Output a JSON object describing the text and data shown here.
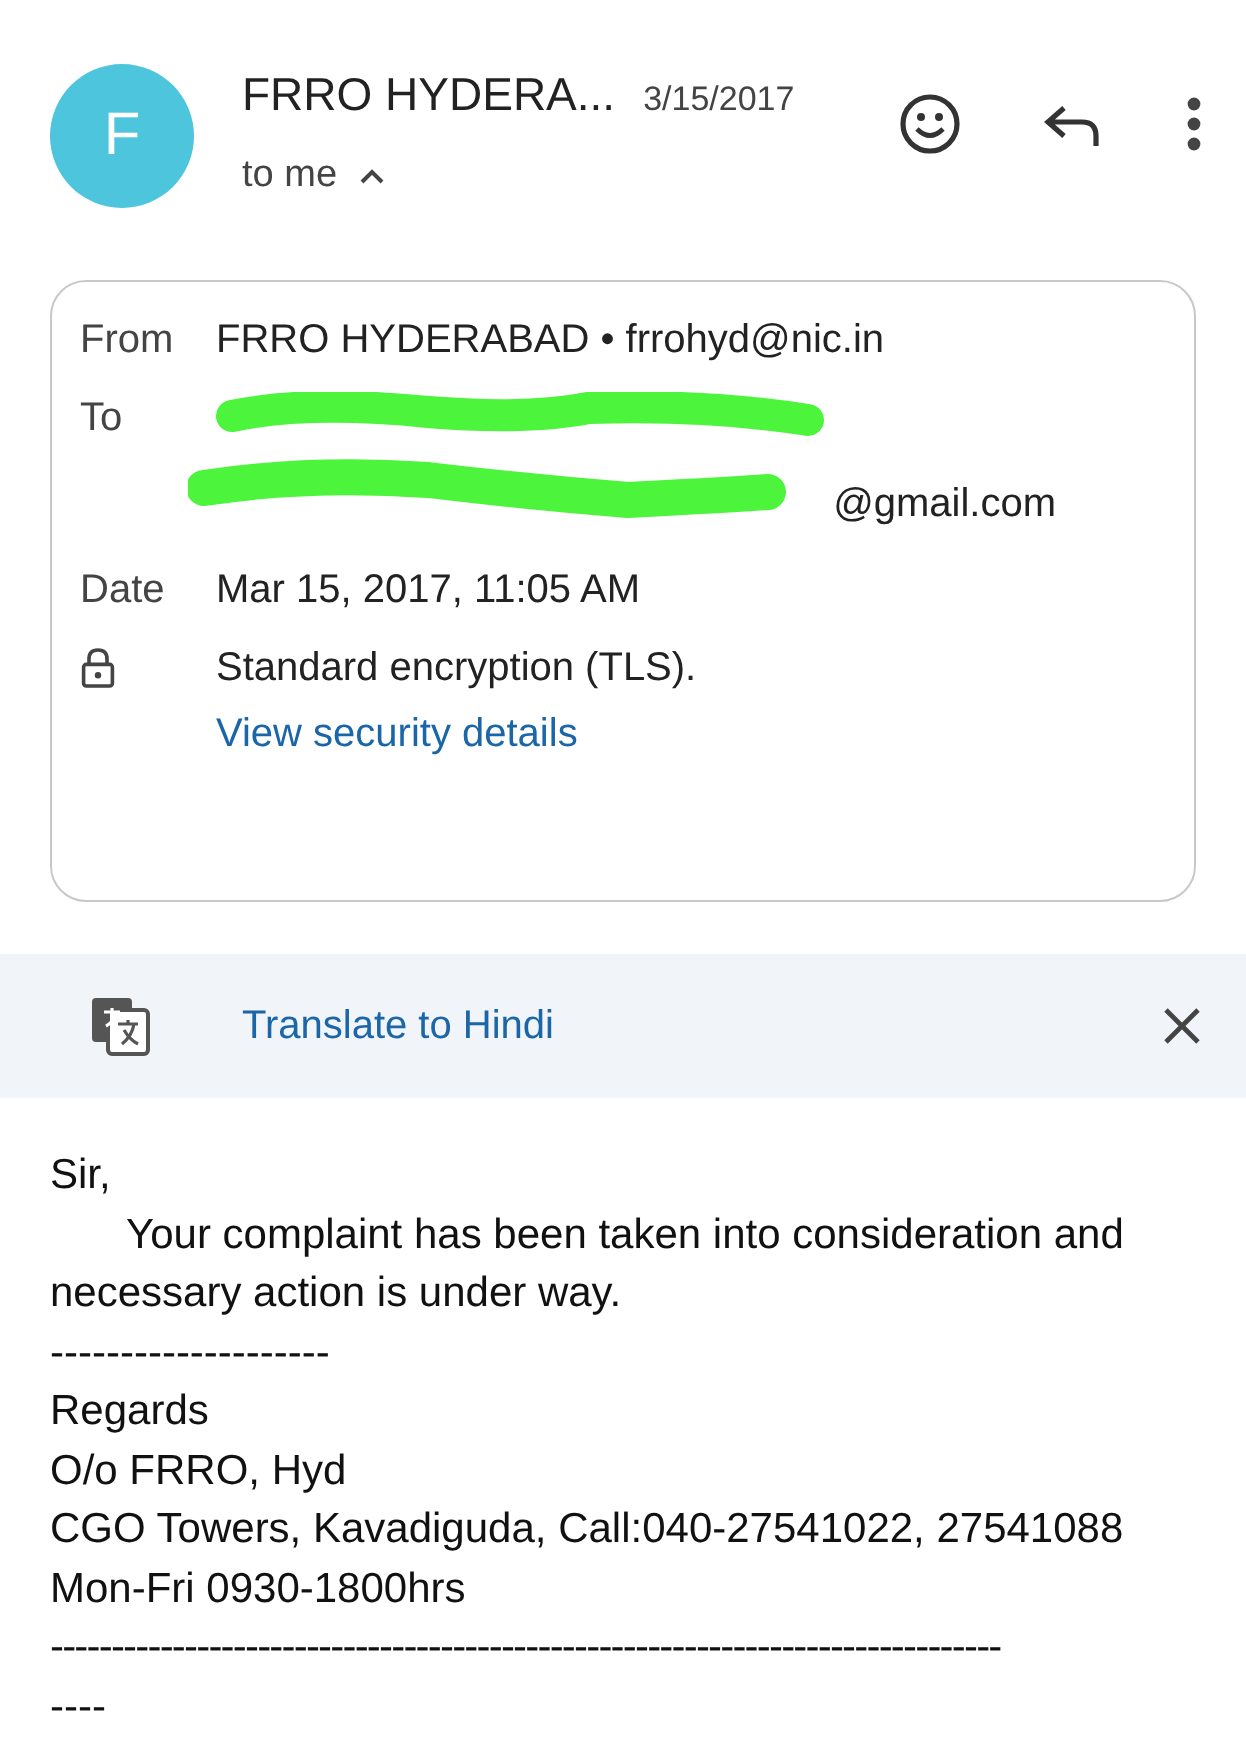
{
  "header": {
    "avatar_letter": "F",
    "sender": "FRRO HYDERA...",
    "date": "3/15/2017",
    "recipient": "to me",
    "details_expanded": true
  },
  "details": {
    "from_label": "From",
    "from_name": "FRRO HYDERABAD",
    "from_sep": "•",
    "from_email": "frrohyd@nic.in",
    "to_label": "To",
    "to_visible": "@gmail.com",
    "to_redacted": true,
    "date_label": "Date",
    "date_value": "Mar 15, 2017, 11:05 AM",
    "encryption": "Standard encryption (TLS).",
    "security_link": "View security details"
  },
  "translate": {
    "label": "Translate to Hindi"
  },
  "body": [
    {
      "kind": "line",
      "text": "Sir,"
    },
    {
      "kind": "indent",
      "text": "Your complaint has been taken into consideration and necessary action is under way."
    },
    {
      "kind": "line",
      "text": "--------------------"
    },
    {
      "kind": "line",
      "text": "Regards"
    },
    {
      "kind": "line",
      "text": "O/o FRRO, Hyd"
    },
    {
      "kind": "line",
      "text": "CGO Towers, Kavadiguda, Call:040-27541022, 27541088 Mon-Fri 0930-1800hrs"
    },
    {
      "kind": "rule",
      "text": "------------------------------------------------------------------------------"
    },
    {
      "kind": "line",
      "text": "----"
    }
  ]
}
